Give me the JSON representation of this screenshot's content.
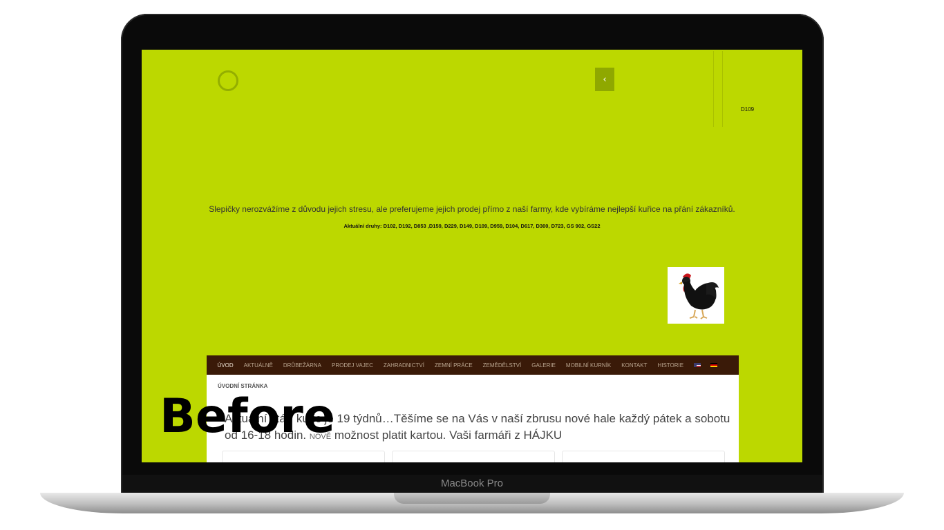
{
  "device_label": "MacBook Pro",
  "overlay_label": "Before",
  "site": {
    "slider": {
      "prev_symbol": "‹",
      "slide_label": "D109"
    },
    "tagline": "Slepičky nerozvážíme z důvodu jejich stresu, ale preferujeme jejich prodej přímo z naší farmy, kde vybíráme nejlepší kuřice na přání zákazníků.",
    "breeds": "Aktuální druhy: D102, D192, D853 ,D159, D229, D149, D109, D959, D104, D617, D300, D723, GS 902, GS22",
    "nav": {
      "items": [
        "ÚVOD",
        "AKTUÁLNĚ",
        "DRŮBEŽÁRNA",
        "PRODEJ VAJEC",
        "ZAHRADNICTVÍ",
        "ZEMNÍ PRÁCE",
        "ZEMĚDĚLSTVÍ",
        "GALERIE",
        "MOBILNÍ KURNÍK",
        "KONTAKT",
        "HISTORIE"
      ],
      "flags": [
        "flag-en-icon",
        "flag-de-icon"
      ]
    },
    "breadcrumb": "ÚVODNÍ STRÁNKA",
    "announcement": {
      "part1": "Aktuální stáří kuřic je 19 týdnů…Těšíme se na Vás v naší zbrusu nové hale každý pátek a sobotu od 16-18 hodin.",
      "new_tag": "NOVĚ",
      "part2": "možnost platit kartou. Vaši farmáři z HÁJKU"
    }
  },
  "colors": {
    "page_bg": "#bcd800",
    "nav_bg": "#3a1a08",
    "nav_text": "#b9a58f"
  }
}
